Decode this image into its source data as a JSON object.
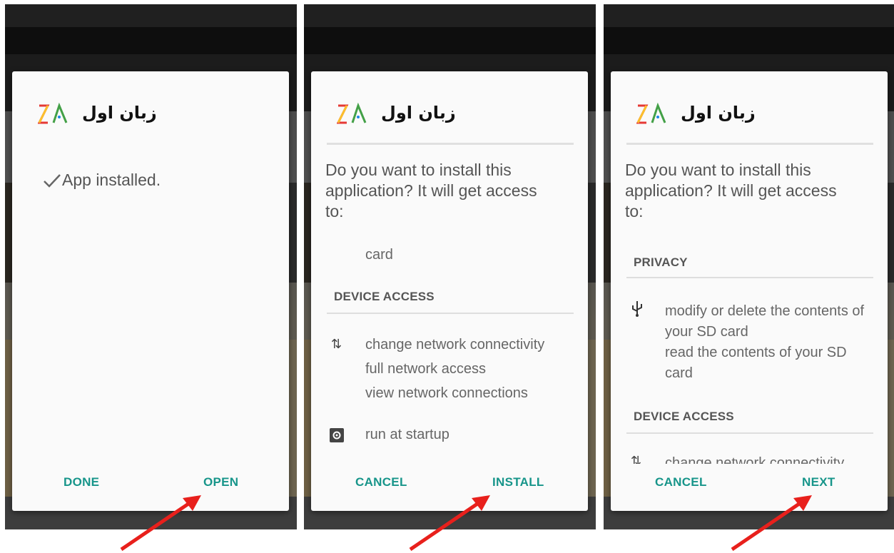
{
  "app_name": "زبان اول",
  "colors": {
    "accent": "#17958a",
    "arrow": "#e8201c"
  },
  "panel1": {
    "status_icon": "check-icon",
    "status_text": "App installed.",
    "buttons": {
      "left": "DONE",
      "right": "OPEN"
    }
  },
  "panel2": {
    "question": [
      "Do you want to install this",
      "application? It will get access",
      "to:"
    ],
    "partial_text": "card",
    "section": "DEVICE ACCESS",
    "network_permissions": [
      "change network connectivity",
      "full network access",
      "view network connections"
    ],
    "startup_permission": "run at startup",
    "buttons": {
      "left": "CANCEL",
      "right": "INSTALL"
    }
  },
  "panel3": {
    "question": [
      "Do you want to install this",
      "application? It will get access",
      "to:"
    ],
    "section_privacy": "PRIVACY",
    "storage_permissions": [
      "modify or delete the contents of",
      "your SD card",
      "read the contents of your SD",
      "card"
    ],
    "section_device": "DEVICE ACCESS",
    "cutoff_permission": "change network connectivity",
    "buttons": {
      "left": "CANCEL",
      "right": "NEXT"
    }
  }
}
